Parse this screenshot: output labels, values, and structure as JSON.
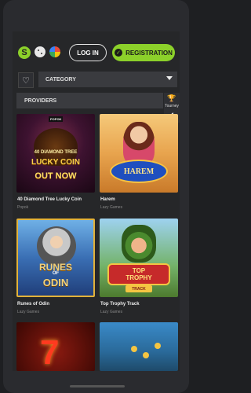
{
  "header": {
    "logo_letter": "S",
    "login_label": "LOG IN",
    "register_label": "REGISTRATION",
    "register_check": "✓"
  },
  "filters": {
    "favorite_icon": "♡",
    "category_label": "CATEGORY",
    "providers_label": "PROVIDERS"
  },
  "sidebar": {
    "tourney_icon": "🏆",
    "tourney_label": "Tourney"
  },
  "games": [
    {
      "title": "40 Diamond Tree Lucky Coin",
      "provider": "Popok",
      "art": {
        "line1": "40 DIAMOND TREE",
        "line2": "LUCKY COIN",
        "line3": "OUT NOW",
        "badge": "POPOK"
      }
    },
    {
      "title": "Harem",
      "provider": "Lazy Games",
      "art": {
        "logo": "HAREM"
      }
    },
    {
      "title": "Runes of Odin",
      "provider": "Lazy Games",
      "art": {
        "line1": "RUNES",
        "line2": "OF",
        "line3": "ODIN"
      }
    },
    {
      "title": "Top Trophy Track",
      "provider": "Lazy Games",
      "art": {
        "line1": "TOP",
        "line2": "TROPHY",
        "line3": "TRACK"
      }
    },
    {
      "art": {
        "symbol": "7"
      }
    },
    {}
  ],
  "colors": {
    "accent": "#8cd12a",
    "background": "#262729",
    "panel": "#3a3b3f"
  }
}
